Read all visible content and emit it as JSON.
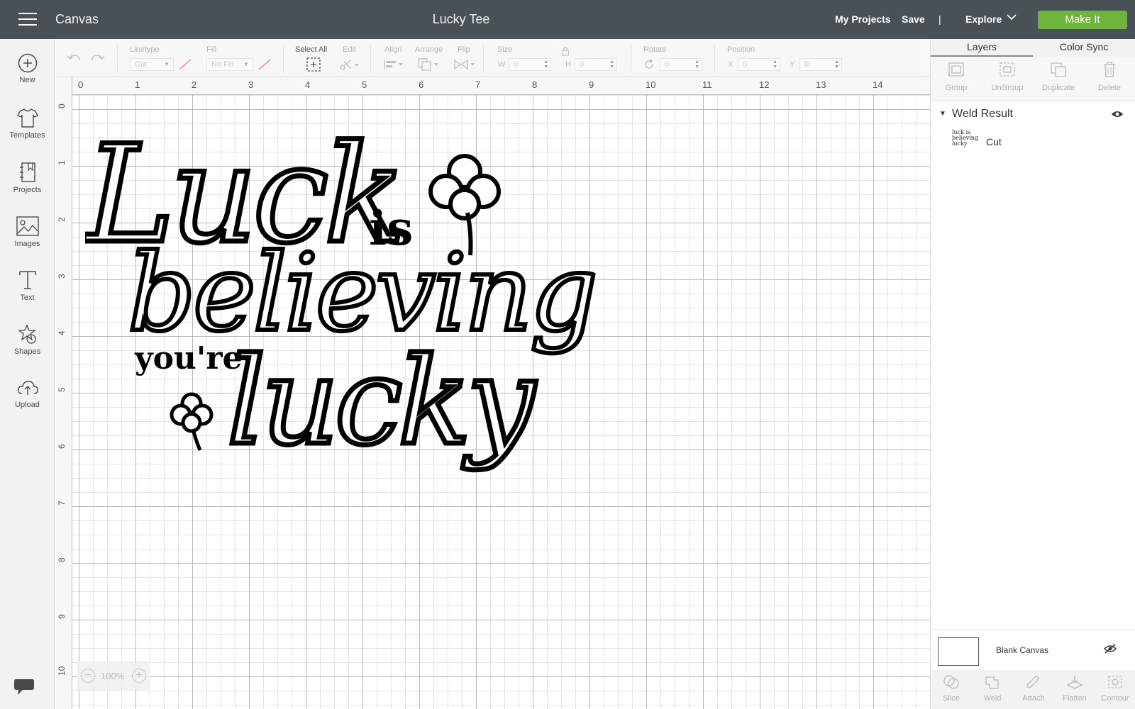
{
  "header": {
    "app_title": "Canvas",
    "project_title": "Lucky Tee",
    "nav": {
      "my_projects": "My Projects",
      "save": "Save",
      "separator": "|",
      "explore": "Explore"
    },
    "make_it": "Make It"
  },
  "sidebar": {
    "items": [
      {
        "label": "New",
        "icon": "plus-circle-icon"
      },
      {
        "label": "Templates",
        "icon": "tshirt-icon"
      },
      {
        "label": "Projects",
        "icon": "notebook-icon"
      },
      {
        "label": "Images",
        "icon": "image-icon"
      },
      {
        "label": "Text",
        "icon": "text-icon"
      },
      {
        "label": "Shapes",
        "icon": "shapes-icon"
      },
      {
        "label": "Upload",
        "icon": "cloud-upload-icon"
      }
    ]
  },
  "toolbar": {
    "linetype_label": "Linetype",
    "linetype_value": "Cut",
    "fill_label": "Fill",
    "fill_value": "No Fill",
    "select_all_label": "Select All",
    "edit_label": "Edit",
    "align_label": "Align",
    "arrange_label": "Arrange",
    "flip_label": "Flip",
    "size_label": "Size",
    "w_label": "W",
    "w_value": "0",
    "h_label": "H",
    "h_value": "0",
    "rotate_label": "Rotate",
    "rotate_value": "0",
    "position_label": "Position",
    "x_label": "X",
    "x_value": "0",
    "y_label": "Y",
    "y_value": "0"
  },
  "rulers": {
    "horizontal": [
      "0",
      "1",
      "2",
      "3",
      "4",
      "5",
      "6",
      "7",
      "8",
      "9",
      "10",
      "11",
      "12",
      "13",
      "14"
    ],
    "vertical": [
      "0",
      "1",
      "2",
      "3",
      "4",
      "5",
      "6",
      "7",
      "8",
      "9",
      "10"
    ]
  },
  "design": {
    "line1": "Luck",
    "line1_small": "is",
    "line2": "believing",
    "line3_small": "you're",
    "line3": "lucky"
  },
  "zoom": {
    "minus": "−",
    "value": "100%",
    "plus": "+"
  },
  "layers_panel": {
    "tabs": [
      "Layers",
      "Color Sync"
    ],
    "actions": [
      "Group",
      "UnGroup",
      "Duplicate",
      "Delete"
    ],
    "group_title": "Weld Result",
    "layer_name": "Cut",
    "layer_thumb_lines": [
      "luck is",
      "believing",
      "lucky"
    ],
    "blank_canvas": "Blank Canvas",
    "bottom_actions": [
      "Slice",
      "Weld",
      "Attach",
      "Flatten",
      "Contour"
    ]
  },
  "colors": {
    "topbar": "#495157",
    "make_it": "#6fb43f"
  }
}
